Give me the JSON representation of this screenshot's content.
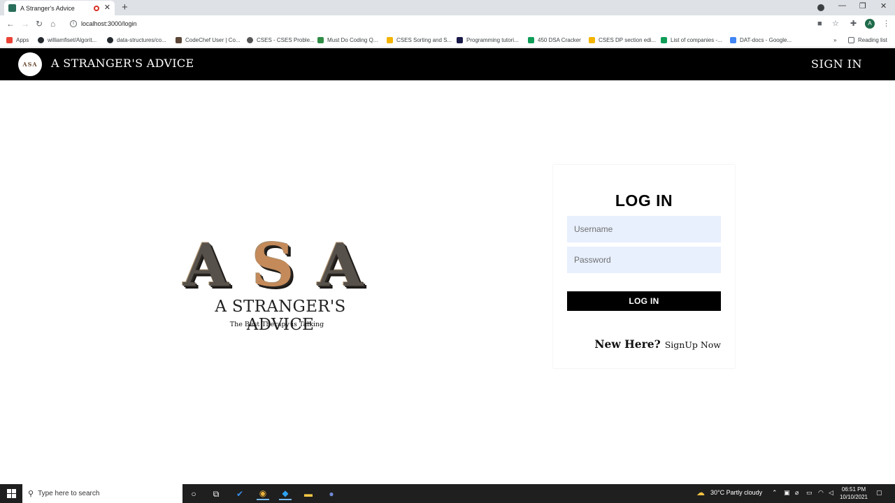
{
  "browser": {
    "tab_title": "A Stranger's Advice",
    "url": "localhost:3000/login",
    "profile_initial": "A",
    "bookmarks": [
      {
        "label": "Apps",
        "color": "#ea4335"
      },
      {
        "label": "williamfiset/Algorit...",
        "color": "#24292e"
      },
      {
        "label": "data-structures/co...",
        "color": "#24292e"
      },
      {
        "label": "CodeChef User | Co...",
        "color": "#5b4638"
      },
      {
        "label": "CSES - CSES Proble...",
        "color": "#555555"
      },
      {
        "label": "Must Do Coding Q...",
        "color": "#2f8d46"
      },
      {
        "label": "CSES Sorting and S...",
        "color": "#f4b400"
      },
      {
        "label": "Programming tutori...",
        "color": "#1a1a4a"
      },
      {
        "label": "450 DSA Cracker",
        "color": "#0f9d58"
      },
      {
        "label": "CSES DP section edi...",
        "color": "#f4b400"
      },
      {
        "label": "List of companies -...",
        "color": "#0f9d58"
      },
      {
        "label": "DAT-docs - Google...",
        "color": "#4285f4"
      }
    ],
    "reading_list": "Reading list"
  },
  "navbar": {
    "brand": "A STRANGER'S ADVICE",
    "logo_text": "ASA",
    "signin": "SIGN IN"
  },
  "hero": {
    "letters": [
      "A",
      "S",
      "A"
    ],
    "title": "A STRANGER'S ADVICE",
    "tagline": "The Best Therapy is Talking"
  },
  "login": {
    "heading": "LOG IN",
    "username_placeholder": "Username",
    "password_placeholder": "Password",
    "button": "LOG IN",
    "new_here": "New Here?",
    "signup_link": "SignUp Now"
  },
  "taskbar": {
    "search_placeholder": "Type here to search",
    "weather": "30°C  Partly cloudy",
    "time": "06:51 PM",
    "date": "10/10/2021"
  }
}
